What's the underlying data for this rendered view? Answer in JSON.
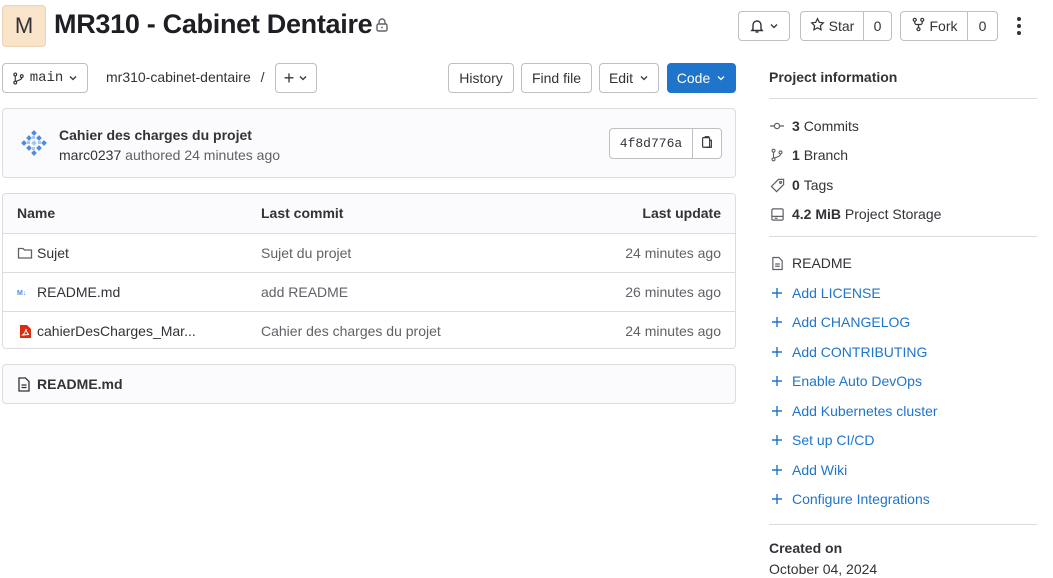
{
  "project": {
    "avatar_letter": "M",
    "title": "MR310 - Cabinet Dentaire"
  },
  "header_actions": {
    "star_label": "Star",
    "star_count": "0",
    "fork_label": "Fork",
    "fork_count": "0"
  },
  "toolbar": {
    "branch": "main",
    "path": "mr310-cabinet-dentaire",
    "path_separator": "/",
    "add_label": "+",
    "history_label": "History",
    "find_file_label": "Find file",
    "edit_label": "Edit",
    "code_label": "Code"
  },
  "last_commit": {
    "title": "Cahier des charges du projet",
    "author": "marc0237",
    "meta": "authored 24 minutes ago",
    "sha": "4f8d776a"
  },
  "files": {
    "headers": {
      "name": "Name",
      "last_commit": "Last commit",
      "last_update": "Last update"
    },
    "rows": [
      {
        "icon": "folder-icon",
        "name": "Sujet",
        "commit": "Sujet du projet",
        "updated": "24 minutes ago"
      },
      {
        "icon": "markdown-icon",
        "name": "README.md",
        "commit": "add README",
        "updated": "26 minutes ago"
      },
      {
        "icon": "pdf-icon",
        "name": "cahierDesCharges_Mar...",
        "commit": "Cahier des charges du projet",
        "updated": "24 minutes ago"
      }
    ]
  },
  "readme_box": {
    "filename": "README.md"
  },
  "sidebar": {
    "title": "Project information",
    "stats": [
      {
        "icon": "commit-icon",
        "value": "3",
        "label": "Commits"
      },
      {
        "icon": "branch-icon",
        "value": "1",
        "label": "Branch"
      },
      {
        "icon": "tag-icon",
        "value": "0",
        "label": "Tags"
      },
      {
        "icon": "storage-icon",
        "value": "4.2 MiB",
        "label": "Project Storage"
      }
    ],
    "readme_label": "README",
    "actions": [
      "Add LICENSE",
      "Add CHANGELOG",
      "Add CONTRIBUTING",
      "Enable Auto DevOps",
      "Add Kubernetes cluster",
      "Set up CI/CD",
      "Add Wiki",
      "Configure Integrations"
    ],
    "created_label": "Created on",
    "created_date": "October 04, 2024"
  },
  "colors": {
    "accent": "#1f75cb",
    "avatar_bg": "#f9e3c9",
    "pdf_red": "#dd2b0e",
    "border": "#dcdcde"
  }
}
